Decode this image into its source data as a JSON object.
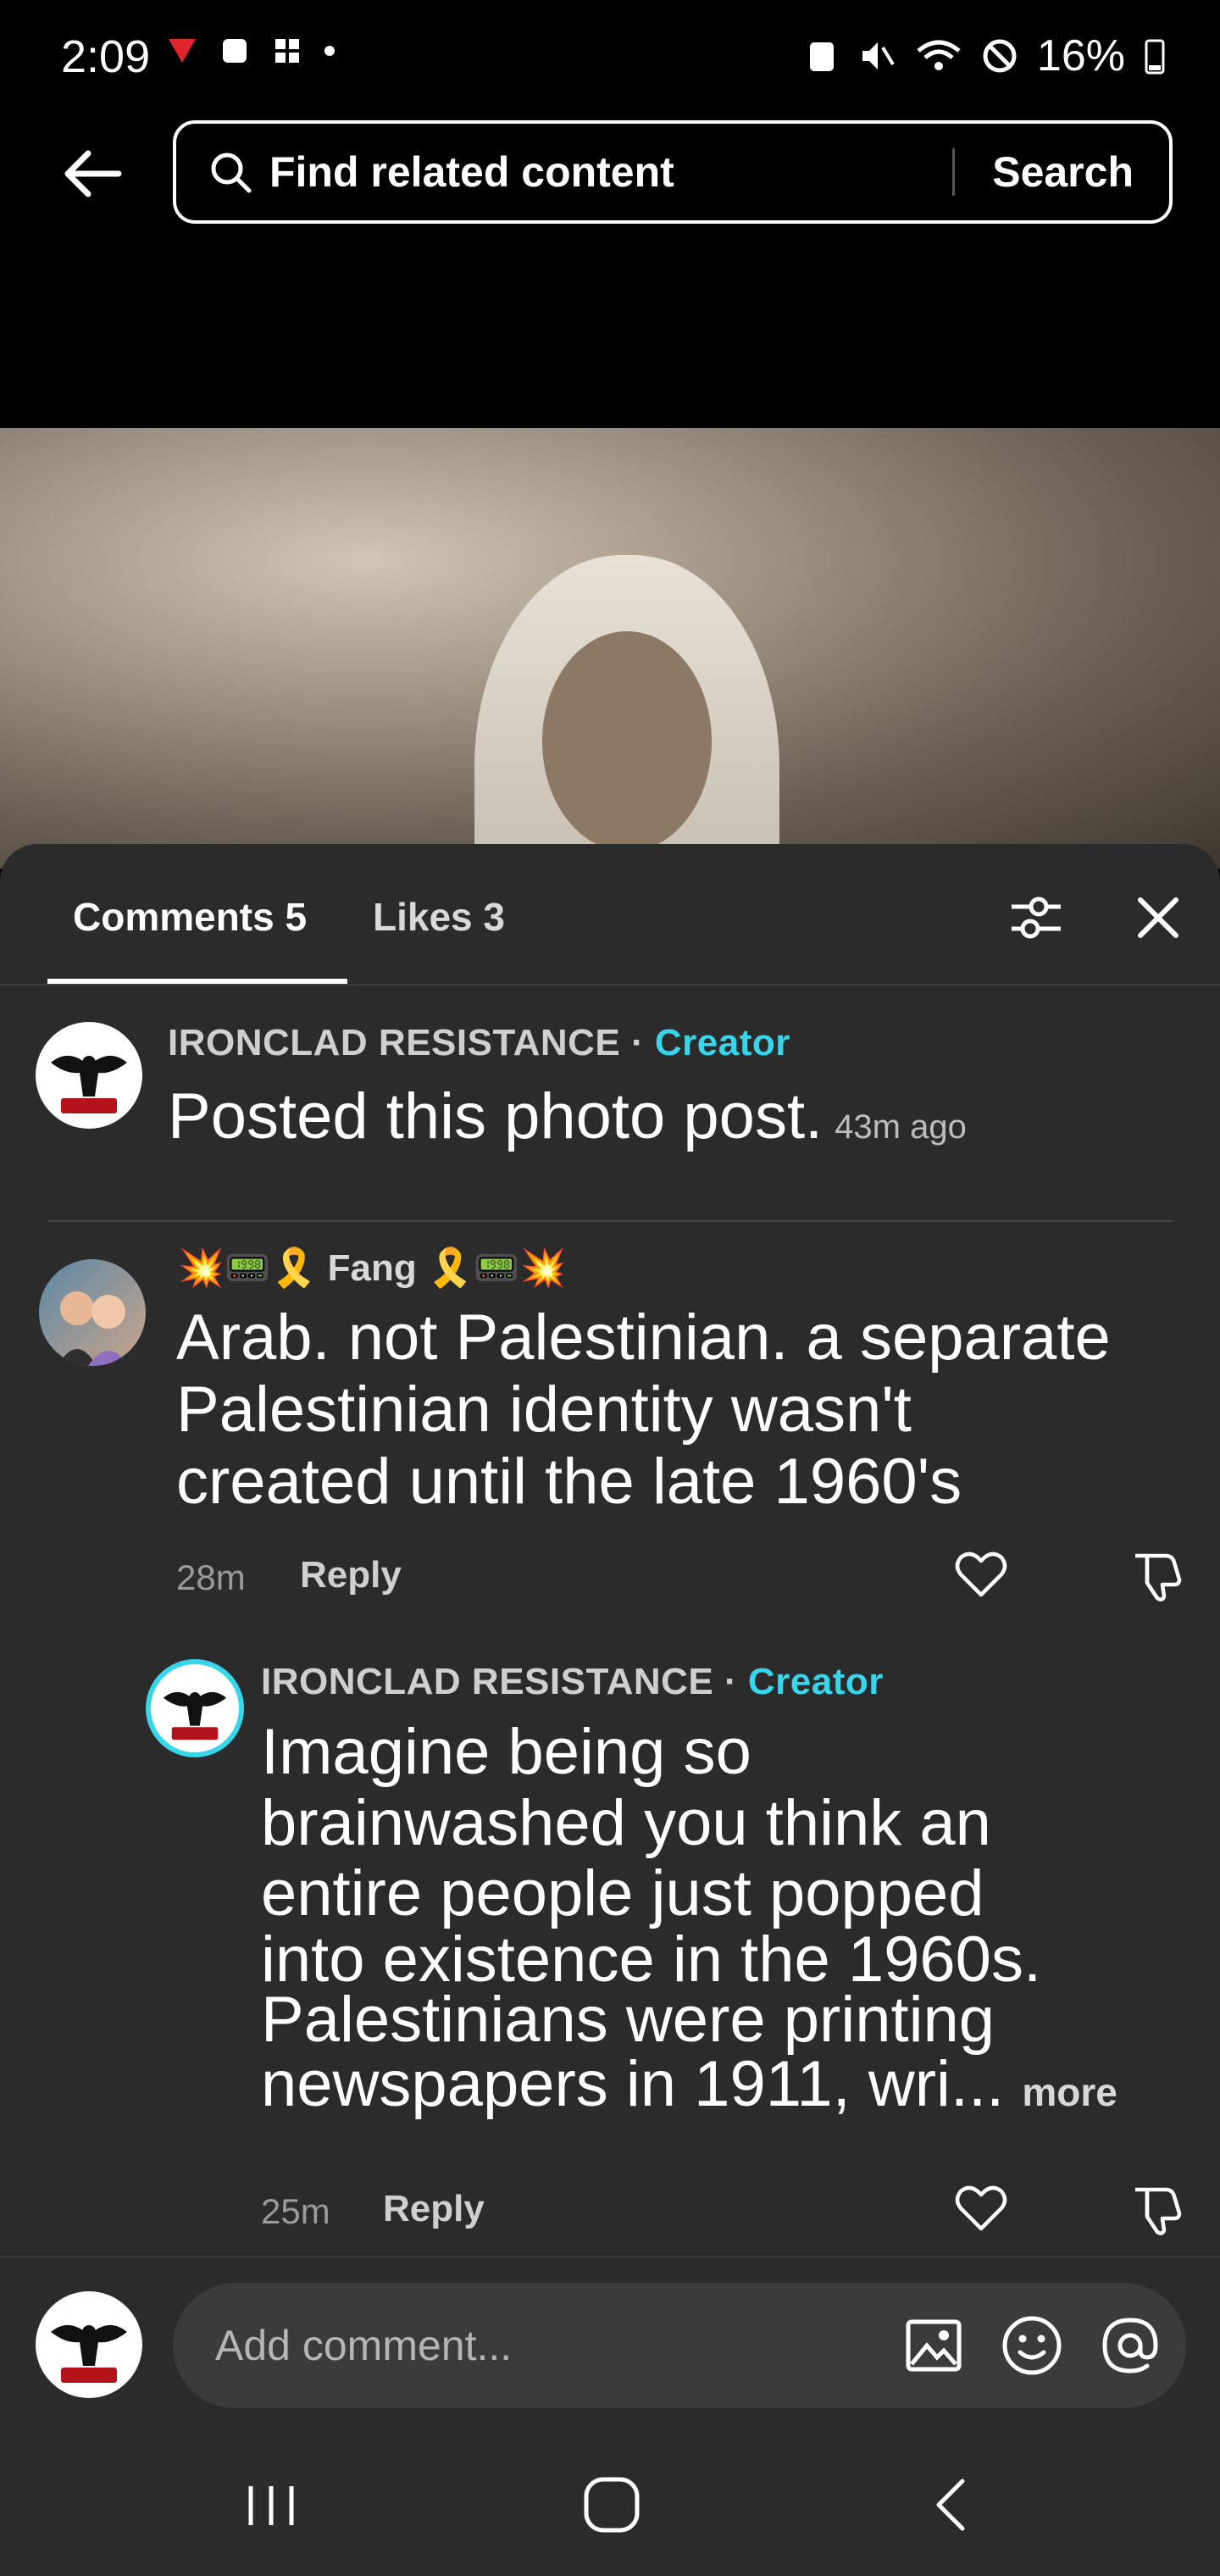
{
  "status_bar": {
    "time": "2:09",
    "battery": "16%"
  },
  "header": {
    "search_placeholder": "Find related content",
    "search_button": "Search"
  },
  "tabs": {
    "comments": "Comments 5",
    "likes": "Likes 3"
  },
  "creator_post": {
    "username": "IRONCLAD RESISTANCE",
    "separator": "·",
    "creator_label": "Creator",
    "text": "Posted this photo post.",
    "time": "43m ago"
  },
  "comment1": {
    "emoji_left": "💥📟🎗️",
    "username": "Fang",
    "emoji_right": "🎗️📟💥",
    "lines": [
      "Arab. not Palestinian. a separate",
      "Palestinian identity wasn't",
      "created until the late 1960's"
    ],
    "time": "28m",
    "reply_label": "Reply"
  },
  "reply1": {
    "username": "IRONCLAD RESISTANCE",
    "separator": "·",
    "creator_label": "Creator",
    "lines": [
      "Imagine being so",
      "brainwashed you think an",
      "entire people just popped",
      "into existence in the 1960s.",
      "Palestinians were printing",
      "newspapers in 1911, wri..."
    ],
    "more_label": "more",
    "time": "25m",
    "reply_label": "Reply"
  },
  "composer": {
    "placeholder": "Add comment..."
  },
  "colors": {
    "creator_accent": "#38d6ea",
    "sheet_bg": "#2b2b2b"
  },
  "icons": [
    "back-arrow-icon",
    "search-icon",
    "filter-icon",
    "close-icon",
    "heart-icon",
    "dislike-icon",
    "image-icon",
    "emoji-icon",
    "mention-icon",
    "recent-apps-icon",
    "home-icon",
    "nav-back-icon"
  ]
}
